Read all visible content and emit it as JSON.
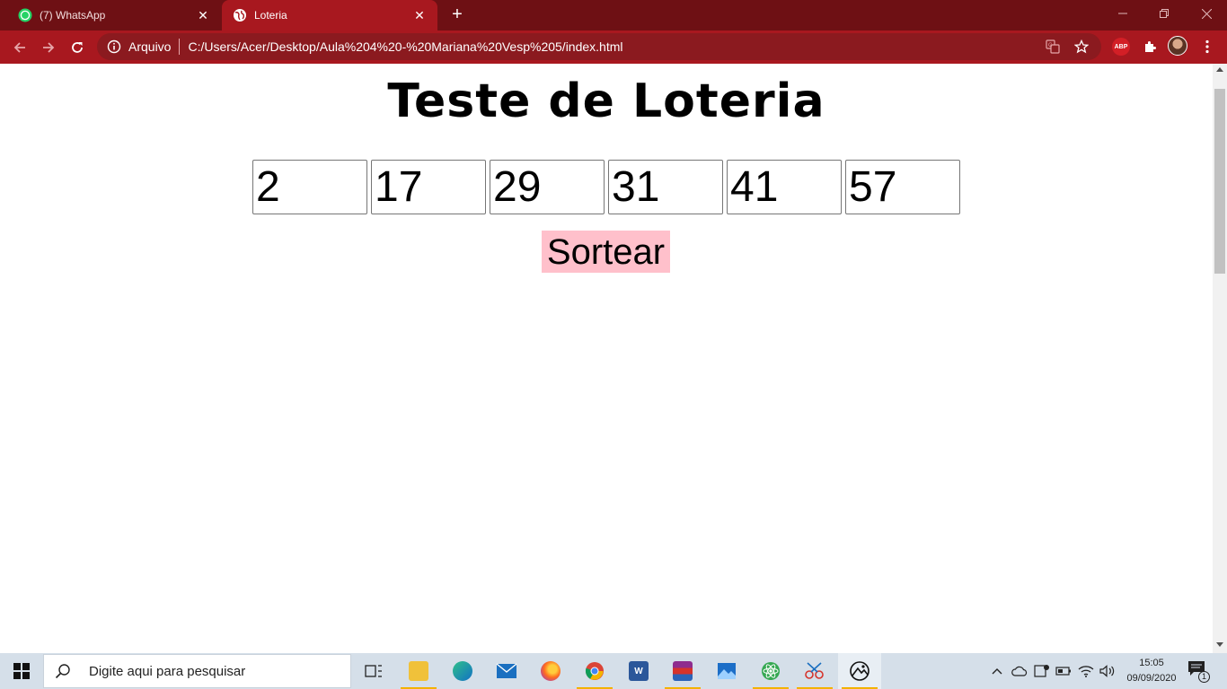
{
  "browser": {
    "tabs": [
      {
        "title": "(7) WhatsApp",
        "icon": "whatsapp-icon",
        "active": false
      },
      {
        "title": "Loteria",
        "icon": "globe-icon",
        "active": true
      }
    ],
    "omnibox": {
      "security_chip": "Arquivo",
      "url": "C:/Users/Acer/Desktop/Aula%204%20-%20Mariana%20Vesp%205/index.html"
    },
    "extensions": {
      "abp_label": "ABP"
    },
    "colors": {
      "frame": "#6e1014",
      "toolbar": "#a8181f",
      "omnibox": "#8b1a1f"
    }
  },
  "page": {
    "title": "Teste de Loteria",
    "numbers": [
      "2",
      "17",
      "29",
      "31",
      "41",
      "57"
    ],
    "draw_button_label": "Sortear",
    "draw_button_color": "#ffc0cb"
  },
  "taskbar": {
    "search_placeholder": "Digite aqui para pesquisar",
    "apps": [
      "task-view-icon",
      "file-explorer-icon",
      "edge-icon",
      "mail-icon",
      "firefox-icon",
      "chrome-icon",
      "word-icon",
      "winrar-icon",
      "photos-icon",
      "atom-icon",
      "snipping-tool-icon",
      "app-icon"
    ],
    "clock": {
      "time": "15:05",
      "date": "09/09/2020"
    },
    "notifications_count": "1"
  }
}
